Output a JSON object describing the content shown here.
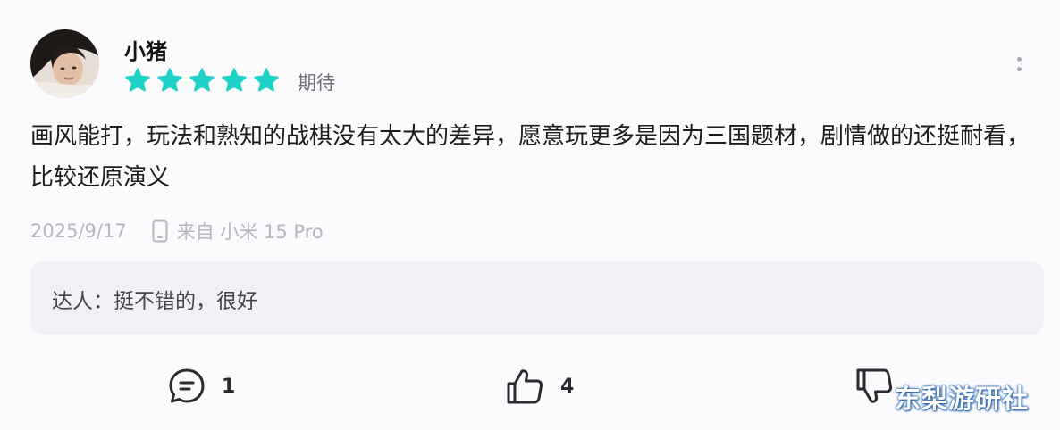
{
  "user": {
    "name": "小猪",
    "rating": 5,
    "rating_max": 5,
    "rating_label": "期待",
    "avatar_icon": "user-avatar-photo"
  },
  "review": {
    "text": "画风能打，玩法和熟知的战棋没有太大的差异，愿意玩更多是因为三国题材，剧情做的还挺耐看，比较还原演义",
    "date": "2025/9/17",
    "device": "来自 小米 15 Pro",
    "device_icon": "phone-icon"
  },
  "reply": {
    "text": "达人：挺不错的，很好"
  },
  "actions": {
    "comments": {
      "icon": "comment-icon",
      "count": "1"
    },
    "likes": {
      "icon": "thumbs-up-icon",
      "count": "4"
    },
    "dislikes": {
      "icon": "thumbs-down-icon"
    }
  },
  "menu_icon": "more-vertical-icon",
  "watermark": "东梨游研社",
  "colors": {
    "star": "#1fd1c6",
    "text_primary": "#1c1c1e",
    "text_muted": "#b4b7bd",
    "reply_bg": "#f0f1f5"
  }
}
